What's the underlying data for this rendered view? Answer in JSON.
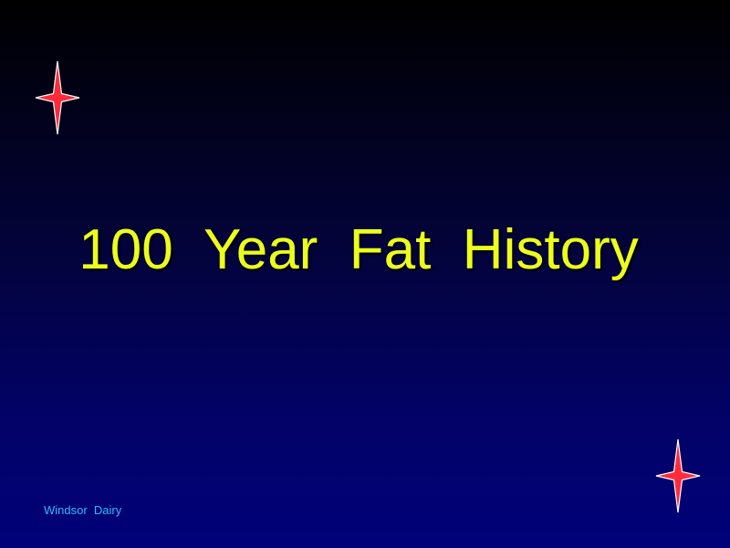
{
  "slide": {
    "title": "100  Year  Fat  History",
    "footer": "Windsor  Dairy"
  },
  "decorations": {
    "stars": [
      "four-point-star-icon",
      "four-point-star-icon"
    ],
    "star_fill": "#ff2b3a",
    "star_outline": "#ffffff"
  },
  "colors": {
    "title": "#ecff1a",
    "footer": "#2fb8ff",
    "background_top": "#000000",
    "background_bottom": "#01017a"
  }
}
